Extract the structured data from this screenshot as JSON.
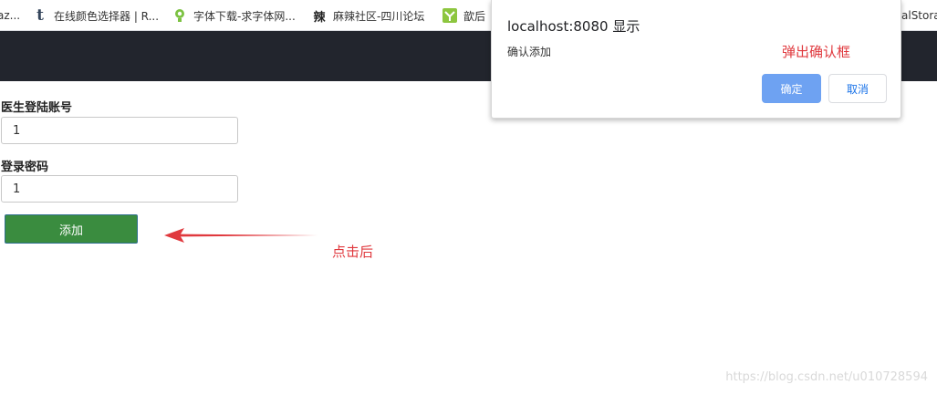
{
  "bookmarks": [
    {
      "label": "az...",
      "icon": "cut-off-bookmark"
    },
    {
      "label": "在线颜色选择器 | R...",
      "icon": "tumblr-t-icon"
    },
    {
      "label": "字体下载-求字体网...",
      "icon": "lightbulb-icon"
    },
    {
      "label": "麻辣社区-四川论坛",
      "icon": "han-character-icon"
    },
    {
      "label": "歆后",
      "icon": "green-leaf-icon"
    },
    {
      "label": "alStora",
      "icon": "cut-off-bookmark"
    }
  ],
  "bookmark_icon_glyphs": {
    "tumblr": "t",
    "han": "辣"
  },
  "form": {
    "account_label": "医生登陆账号",
    "account_value": "1",
    "password_label": "登录密码",
    "password_value": "1",
    "add_button": "添加"
  },
  "dialog": {
    "title": "localhost:8080 显示",
    "message": "确认添加",
    "ok_label": "确定",
    "cancel_label": "取消"
  },
  "annotations": {
    "dialog_note": "弹出确认框",
    "click_note": "点击后"
  },
  "watermark": "https://blog.csdn.net/u010728594",
  "colors": {
    "nav_band": "#22252d",
    "add_button": "#3a8c3f",
    "ok_button": "#6ea2f2",
    "annotation": "#e0393e"
  }
}
